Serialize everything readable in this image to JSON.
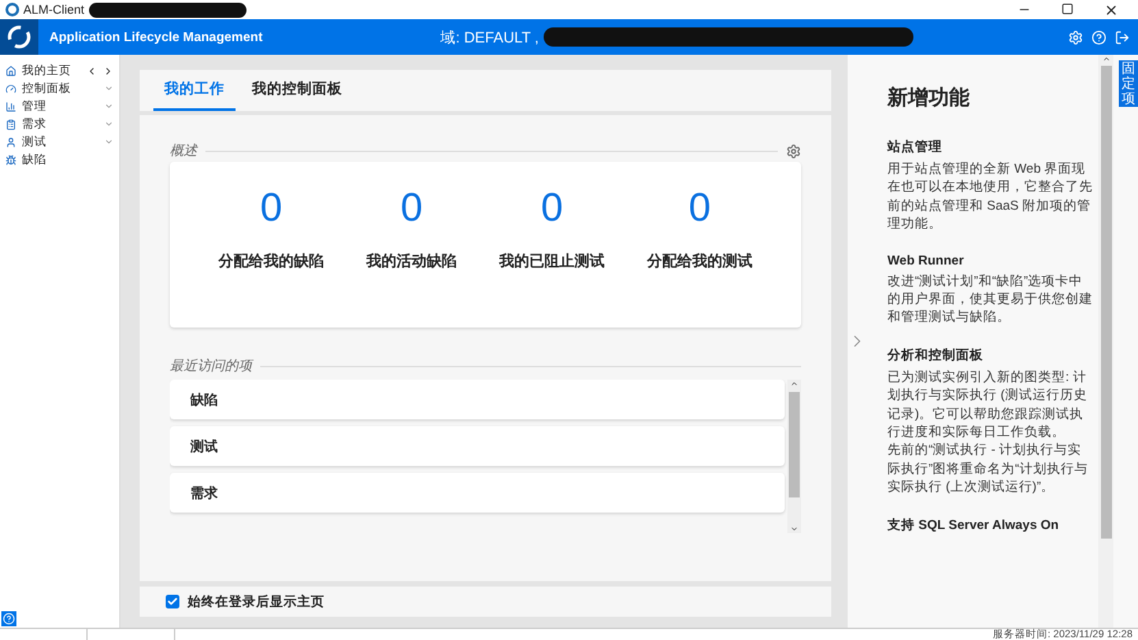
{
  "window": {
    "title": "ALM-Client"
  },
  "header": {
    "title": "Application Lifecycle Management",
    "domain": "域: DEFAULT ,"
  },
  "sidebar": {
    "items": [
      {
        "label": "我的主页",
        "kind": "nav"
      },
      {
        "label": "控制面板",
        "kind": "menu"
      },
      {
        "label": "管理",
        "kind": "menu"
      },
      {
        "label": "需求",
        "kind": "menu"
      },
      {
        "label": "测试",
        "kind": "menu"
      },
      {
        "label": "缺陷",
        "kind": "plain"
      }
    ]
  },
  "tabs": [
    {
      "label": "我的工作",
      "selected": true
    },
    {
      "label": "我的控制面板",
      "selected": false
    }
  ],
  "overview": {
    "title": "概述",
    "stats": [
      {
        "value": "0",
        "label": "分配给我的缺陷"
      },
      {
        "value": "0",
        "label": "我的活动缺陷"
      },
      {
        "value": "0",
        "label": "我的已阻止测试"
      },
      {
        "value": "0",
        "label": "分配给我的测试"
      }
    ]
  },
  "recent": {
    "title": "最近访问的项",
    "items": [
      "缺陷",
      "测试",
      "需求"
    ]
  },
  "show_home": {
    "label": "始终在登录后显示主页",
    "checked": true
  },
  "whats_new": {
    "title": "新增功能",
    "sections": [
      {
        "heading": "站点管理",
        "paragraphs": [
          "用于站点管理的全新 Web 界面现在也可以在本地使用，它整合了先前的站点管理和 SaaS 附加项的管理功能。"
        ]
      },
      {
        "heading": "Web Runner",
        "paragraphs": [
          "改进“测试计划”和“缺陷”选项卡中的用户界面，使其更易于供您创建和管理测试与缺陷。"
        ]
      },
      {
        "heading": "分析和控制面板",
        "paragraphs": [
          "已为测试实例引入新的图类型: 计划执行与实际执行 (测试运行历史记录)。它可以帮助您跟踪测试执行进度和实际每日工作负载。",
          "先前的“测试执行 - 计划执行与实际执行”图将重命名为“计划执行与实际执行 (上次测试运行)”。"
        ]
      },
      {
        "heading": "支持 SQL Server Always On"
      }
    ]
  },
  "pin_tab": {
    "label": "固定项"
  },
  "status_bar": {
    "server_time": "服务器时间: 2023/11/29 12:28"
  }
}
